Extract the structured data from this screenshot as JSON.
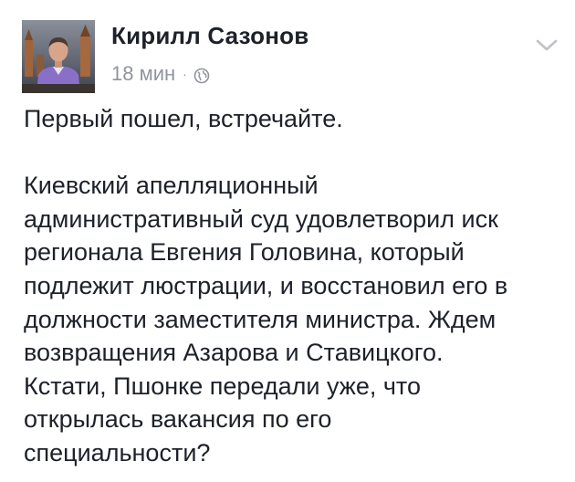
{
  "post": {
    "author": "Кирилл Сазонов",
    "timestamp": "18 мин",
    "separator": "·",
    "privacy_icon": "globe-icon",
    "options_icon": "chevron-down-icon",
    "avatar_icon": "profile-photo",
    "paragraphs": [
      [
        "Первый пошел, встречайте."
      ],
      [
        "Киевский апелляционный",
        "административный суд удовлетворил иск",
        "регионала Евгения Головина, который",
        "подлежит люстрации, и восстановил его в",
        "должности заместителя министра. Ждем",
        "возвращения Азарова и Ставицкого.",
        "Кстати, Пшонке передали уже, что",
        "открылась вакансия по его",
        "специальности?"
      ]
    ]
  },
  "colors": {
    "text": "#1d2129",
    "meta": "#90949c",
    "background": "#ffffff"
  }
}
